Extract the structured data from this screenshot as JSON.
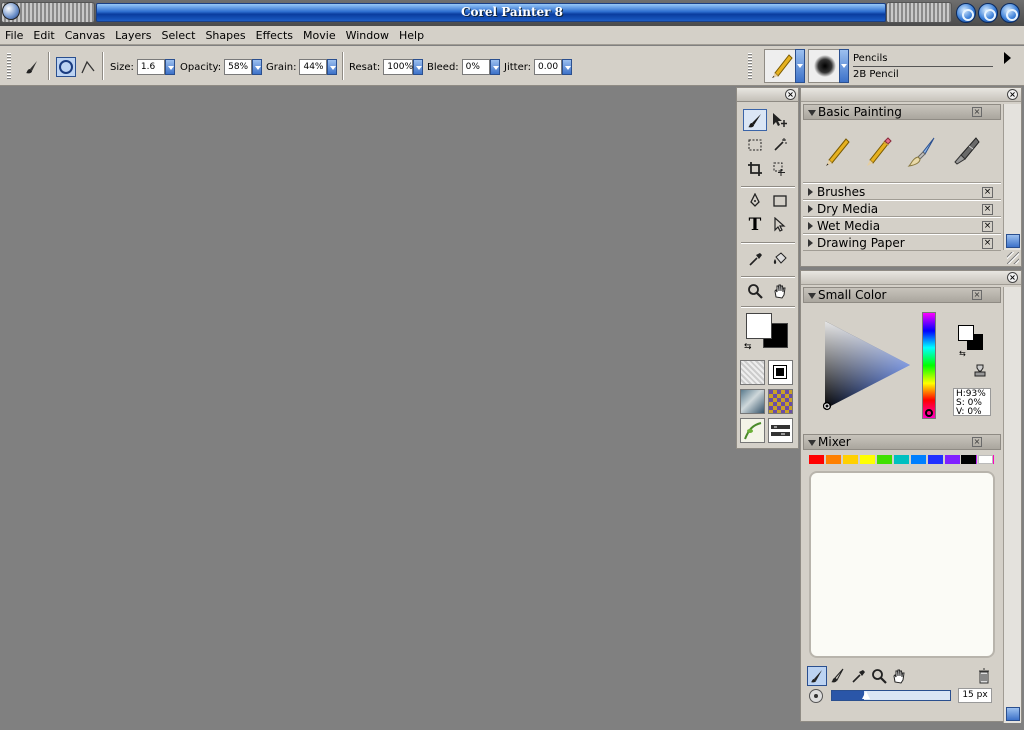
{
  "window": {
    "title": "Corel Painter 8"
  },
  "menu": [
    "File",
    "Edit",
    "Canvas",
    "Layers",
    "Select",
    "Shapes",
    "Effects",
    "Movie",
    "Window",
    "Help"
  ],
  "property_bar": {
    "size": {
      "label": "Size:",
      "value": "1.6"
    },
    "opacity": {
      "label": "Opacity:",
      "value": "58%"
    },
    "grain": {
      "label": "Grain:",
      "value": "44%"
    },
    "resat": {
      "label": "Resat:",
      "value": "100%"
    },
    "bleed": {
      "label": "Bleed:",
      "value": "0%"
    },
    "jitter": {
      "label": "Jitter:",
      "value": "0.00"
    }
  },
  "brush_selector": {
    "category": "Pencils",
    "variant": "2B Pencil"
  },
  "panels": {
    "basic_painting": {
      "title": "Basic Painting",
      "categories": [
        "Brushes",
        "Dry Media",
        "Wet Media",
        "Drawing Paper"
      ]
    },
    "small_color": {
      "title": "Small Color",
      "h": "H:93%",
      "s": "S: 0%",
      "v": "V: 0%"
    },
    "mixer": {
      "title": "Mixer",
      "brush_size": "15 px",
      "swatches": [
        "#ff0000",
        "#ff8000",
        "#ffd000",
        "#ffff00",
        "#40e000",
        "#00c0c0",
        "#0080ff",
        "#2030ff",
        "#8020ff",
        "#c020ff",
        "#ff00c0",
        "#000000",
        "#ffffff"
      ]
    }
  },
  "colors": {
    "canvas_bg": "#808080",
    "primary": "#ffffff",
    "secondary": "#000000"
  }
}
